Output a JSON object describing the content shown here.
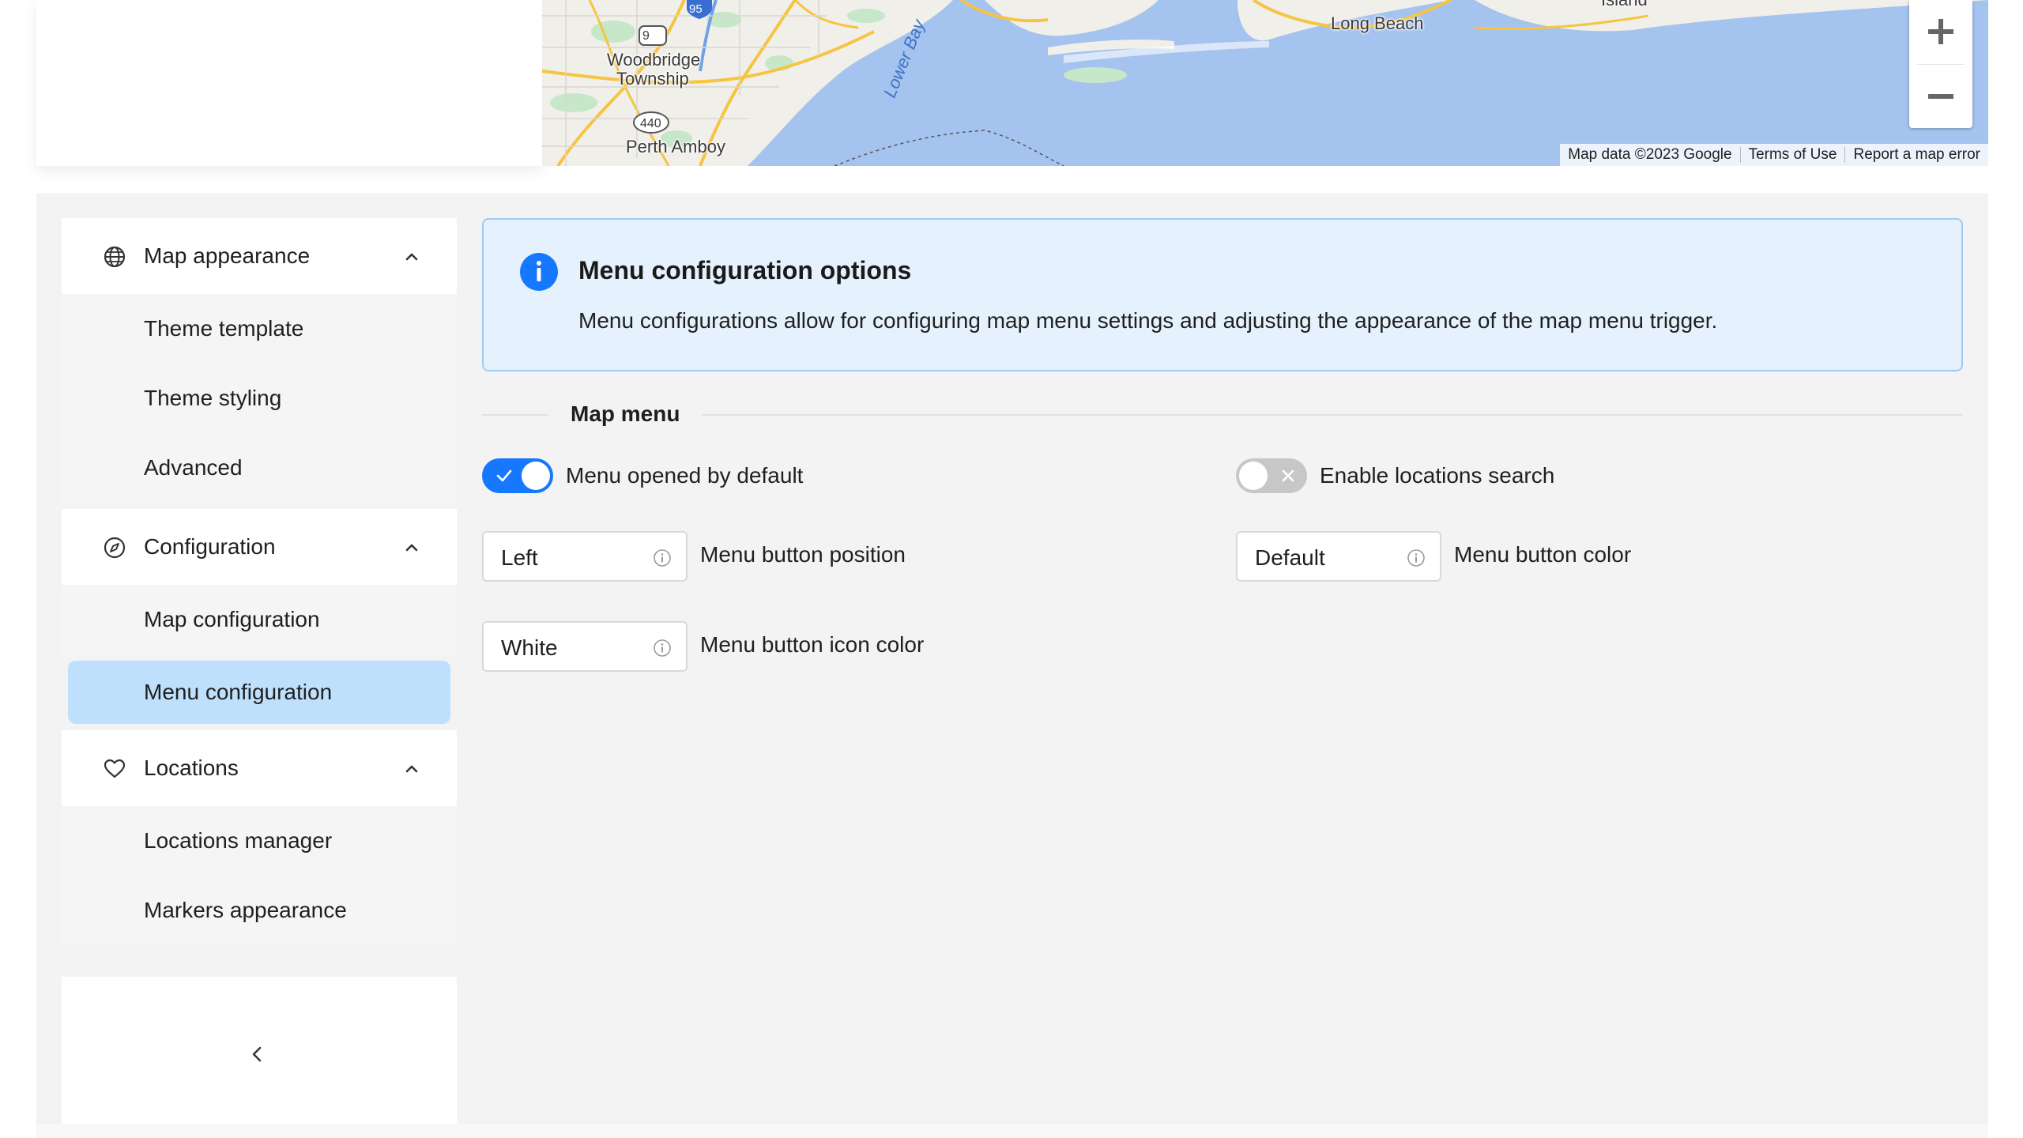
{
  "map": {
    "labels": {
      "woodbridge": "Woodbridge",
      "township": "Township",
      "perth_amboy": "Perth Amboy",
      "long_beach": "Long Beach",
      "island": "Island",
      "lower_bay": "Lower Bay",
      "route_9": "9",
      "route_95": "95",
      "route_440": "440"
    },
    "zoom_in": "+",
    "zoom_out": "−",
    "attribution": {
      "map_data": "Map data ©2023 Google",
      "terms": "Terms of Use",
      "report": "Report a map error"
    }
  },
  "sidebar": {
    "groups": [
      {
        "label": "Map appearance",
        "icon": "globe-icon",
        "items": [
          "Theme template",
          "Theme styling",
          "Advanced"
        ]
      },
      {
        "label": "Configuration",
        "icon": "compass-icon",
        "items": [
          "Map configuration",
          "Menu configuration"
        ]
      },
      {
        "label": "Locations",
        "icon": "heart-icon",
        "items": [
          "Locations manager",
          "Markers appearance"
        ]
      }
    ],
    "active_item": "Menu configuration"
  },
  "content": {
    "info": {
      "title": "Menu configuration options",
      "text": "Menu configurations allow for configuring map menu settings and adjusting the appearance of the map menu trigger."
    },
    "section_title": "Map menu",
    "toggles": {
      "menu_opened": {
        "label": "Menu opened by default",
        "on": true
      },
      "locations_search": {
        "label": "Enable locations search",
        "on": false
      }
    },
    "selects": {
      "position": {
        "value": "Left",
        "label": "Menu button position"
      },
      "color": {
        "value": "Default",
        "label": "Menu button color"
      },
      "icon_color": {
        "value": "White",
        "label": "Menu button icon color"
      }
    }
  },
  "colors": {
    "accent": "#1677ff",
    "active_bg": "#bfe0fd",
    "info_bg": "#e5f2fd",
    "info_border": "#9fcaf5",
    "water": "#a5c3ef"
  }
}
